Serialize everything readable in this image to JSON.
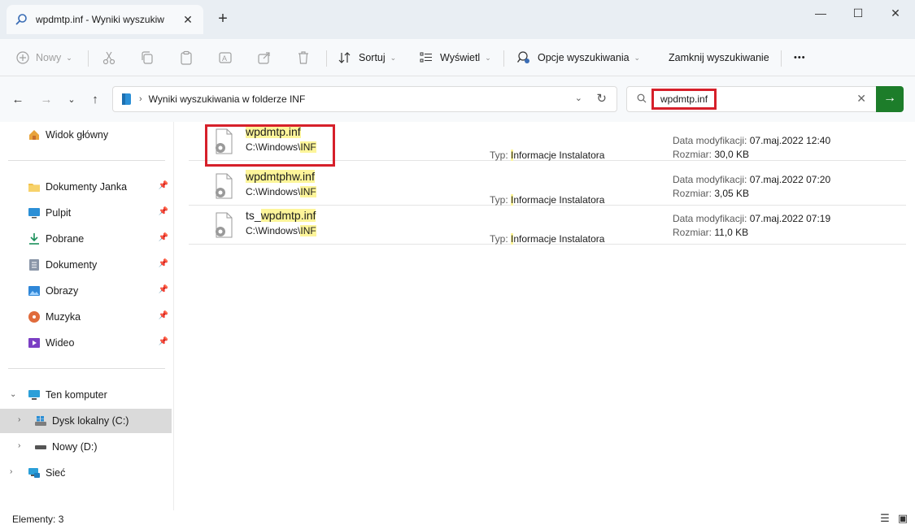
{
  "window": {
    "tab_title": "wpdmtp.inf - Wyniki wyszukiw",
    "tab_close": "✕",
    "new_tab": "+",
    "minimize": "—",
    "maximize": "☐",
    "close": "✕"
  },
  "toolbar": {
    "new_label": "Nowy",
    "sort_label": "Sortuj",
    "view_label": "Wyświetl",
    "search_options_label": "Opcje wyszukiwania",
    "close_search_label": "Zamknij wyszukiwanie",
    "more_label": "•••"
  },
  "address": {
    "path": "Wyniki wyszukiwania w folderze INF",
    "search_value": "wpdmtp.inf"
  },
  "sidebar": {
    "home": "Widok główny",
    "pinned": [
      {
        "label": "Dokumenty Janka",
        "icon": "folder-icon"
      },
      {
        "label": "Pulpit",
        "icon": "desktop-icon"
      },
      {
        "label": "Pobrane",
        "icon": "download-icon"
      },
      {
        "label": "Dokumenty",
        "icon": "documents-icon"
      },
      {
        "label": "Obrazy",
        "icon": "pictures-icon"
      },
      {
        "label": "Muzyka",
        "icon": "music-icon"
      },
      {
        "label": "Wideo",
        "icon": "video-icon"
      }
    ],
    "this_pc": "Ten komputer",
    "drive_c": "Dysk lokalny (C:)",
    "drive_d": "Nowy (D:)",
    "network": "Sieć"
  },
  "results": [
    {
      "name_hl": "wpdmtp.inf",
      "name_rest": "",
      "name_pre": "",
      "path_pre": "C:\\Windows\\",
      "path_hl": "INF",
      "type_label": "Typ: ",
      "type_hl": "I",
      "type_rest": "nformacje Instalatora",
      "date_label": "Data modyfikacji:",
      "date": "07.maj.2022 12:40",
      "size_label": "Rozmiar:",
      "size": "30,0 KB"
    },
    {
      "name_hl": "wpdmtp",
      "name_rest": "hw.inf",
      "name_pre": "",
      "path_pre": "C:\\Windows\\",
      "path_hl": "INF",
      "type_label": "Typ: ",
      "type_hl": "I",
      "type_rest": "nformacje Instalatora",
      "date_label": "Data modyfikacji:",
      "date": "07.maj.2022 07:20",
      "size_label": "Rozmiar:",
      "size": "3,05 KB"
    },
    {
      "name_pre": "ts_",
      "name_hl": "wpdmtp.inf",
      "name_rest": "",
      "path_pre": "C:\\Windows\\",
      "path_hl": "INF",
      "type_label": "Typ: ",
      "type_hl": "I",
      "type_rest": "nformacje Instalatora",
      "date_label": "Data modyfikacji:",
      "date": "07.maj.2022 07:19",
      "size_label": "Rozmiar:",
      "size": "11,0 KB"
    }
  ],
  "status": {
    "count": "Elementy: 3"
  },
  "colors": {
    "accent_green": "#1d7d2a",
    "highlight_red": "#d6202a",
    "match_highlight": "#fdf59a"
  }
}
